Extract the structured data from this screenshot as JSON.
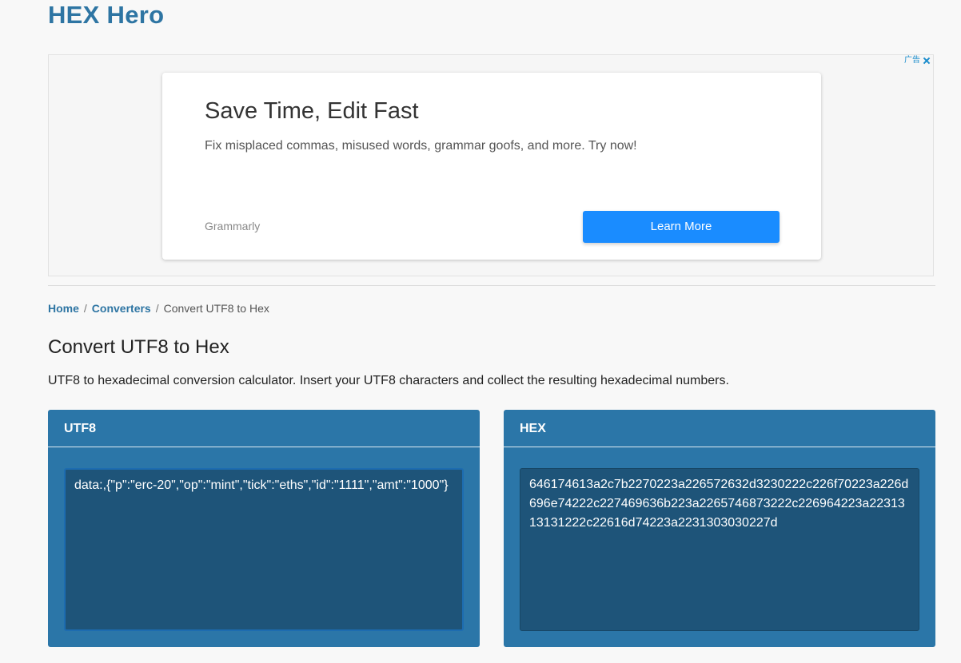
{
  "site": {
    "title": "HEX Hero"
  },
  "ad": {
    "corner_label": "广告",
    "headline": "Save Time, Edit Fast",
    "body": "Fix misplaced commas, misused words, grammar goofs, and more. Try now!",
    "advertiser": "Grammarly",
    "cta": "Learn More"
  },
  "breadcrumb": {
    "home": "Home",
    "converters": "Converters",
    "current": "Convert UTF8 to Hex",
    "separator": "/"
  },
  "page": {
    "title": "Convert UTF8 to Hex",
    "description": "UTF8 to hexadecimal conversion calculator. Insert your UTF8 characters and collect the resulting hexadecimal numbers."
  },
  "utf8_panel": {
    "label": "UTF8",
    "value": "data:,{\"p\":\"erc-20\",\"op\":\"mint\",\"tick\":\"eths\",\"id\":\"1111\",\"amt\":\"1000\"}"
  },
  "hex_panel": {
    "label": "HEX",
    "value": "646174613a2c7b2270223a226572632d3230222c226f70223a226d696e74222c227469636b223a2265746873222c226964223a2231313131222c22616d74223a2231303030227d"
  },
  "colors": {
    "brand": "#2e75a3",
    "panel_bg": "#2b76a8",
    "textarea_bg": "#1e5479",
    "cta_bg": "#1a8cff"
  }
}
